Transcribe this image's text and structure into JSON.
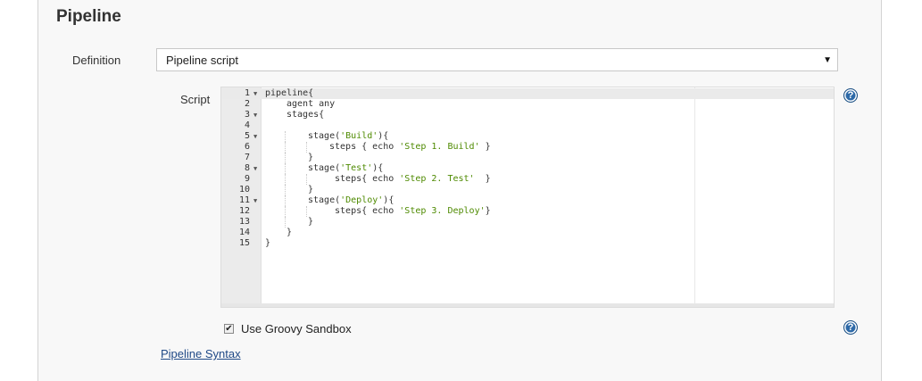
{
  "section": {
    "title": "Pipeline"
  },
  "definition": {
    "label": "Definition",
    "selected": "Pipeline script"
  },
  "script": {
    "label": "Script",
    "lines": [
      {
        "num": "1",
        "fold": true,
        "indent": 0,
        "parts": [
          [
            "pipeline{",
            ""
          ]
        ]
      },
      {
        "num": "2",
        "fold": false,
        "indent": 1,
        "parts": [
          [
            "agent any",
            ""
          ]
        ]
      },
      {
        "num": "3",
        "fold": true,
        "indent": 1,
        "parts": [
          [
            "stages{",
            ""
          ]
        ]
      },
      {
        "num": "4",
        "fold": false,
        "indent": 0,
        "parts": [
          [
            "",
            ""
          ]
        ]
      },
      {
        "num": "5",
        "fold": true,
        "indent": 2,
        "parts": [
          [
            "stage(",
            ""
          ],
          [
            "'Build'",
            "str"
          ],
          [
            "){",
            ""
          ]
        ]
      },
      {
        "num": "6",
        "fold": false,
        "indent": 3,
        "parts": [
          [
            "steps { echo ",
            ""
          ],
          [
            "'Step 1. Build'",
            "str"
          ],
          [
            " }",
            ""
          ]
        ]
      },
      {
        "num": "7",
        "fold": false,
        "indent": 2,
        "parts": [
          [
            "}",
            ""
          ]
        ]
      },
      {
        "num": "8",
        "fold": true,
        "indent": 2,
        "parts": [
          [
            "stage(",
            ""
          ],
          [
            "'Test'",
            "str"
          ],
          [
            "){",
            ""
          ]
        ]
      },
      {
        "num": "9",
        "fold": false,
        "indent": 3,
        "parts": [
          [
            " steps{ echo ",
            ""
          ],
          [
            "'Step 2. Test'",
            "str"
          ],
          [
            "  }",
            ""
          ]
        ]
      },
      {
        "num": "10",
        "fold": false,
        "indent": 2,
        "parts": [
          [
            "}",
            ""
          ]
        ]
      },
      {
        "num": "11",
        "fold": true,
        "indent": 2,
        "parts": [
          [
            "stage(",
            ""
          ],
          [
            "'Deploy'",
            "str"
          ],
          [
            "){",
            ""
          ]
        ]
      },
      {
        "num": "12",
        "fold": false,
        "indent": 3,
        "parts": [
          [
            " steps{ echo ",
            ""
          ],
          [
            "'Step 3. Deploy'",
            "str"
          ],
          [
            "}",
            ""
          ]
        ]
      },
      {
        "num": "13",
        "fold": false,
        "indent": 2,
        "parts": [
          [
            "}",
            ""
          ]
        ]
      },
      {
        "num": "14",
        "fold": false,
        "indent": 1,
        "parts": [
          [
            "}",
            ""
          ]
        ]
      },
      {
        "num": "15",
        "fold": false,
        "indent": 0,
        "parts": [
          [
            "}",
            ""
          ]
        ]
      }
    ]
  },
  "sandbox": {
    "label": "Use Groovy Sandbox",
    "checked": true
  },
  "syntax_link": "Pipeline Syntax",
  "icons": {
    "help": "help-icon",
    "fold": "fold-arrow-icon",
    "dropdown": "dropdown-arrow-icon",
    "check": "checkmark-icon"
  },
  "colors": {
    "link": "#204a87",
    "string": "#4e8a00",
    "help": "#2e6aa8"
  }
}
